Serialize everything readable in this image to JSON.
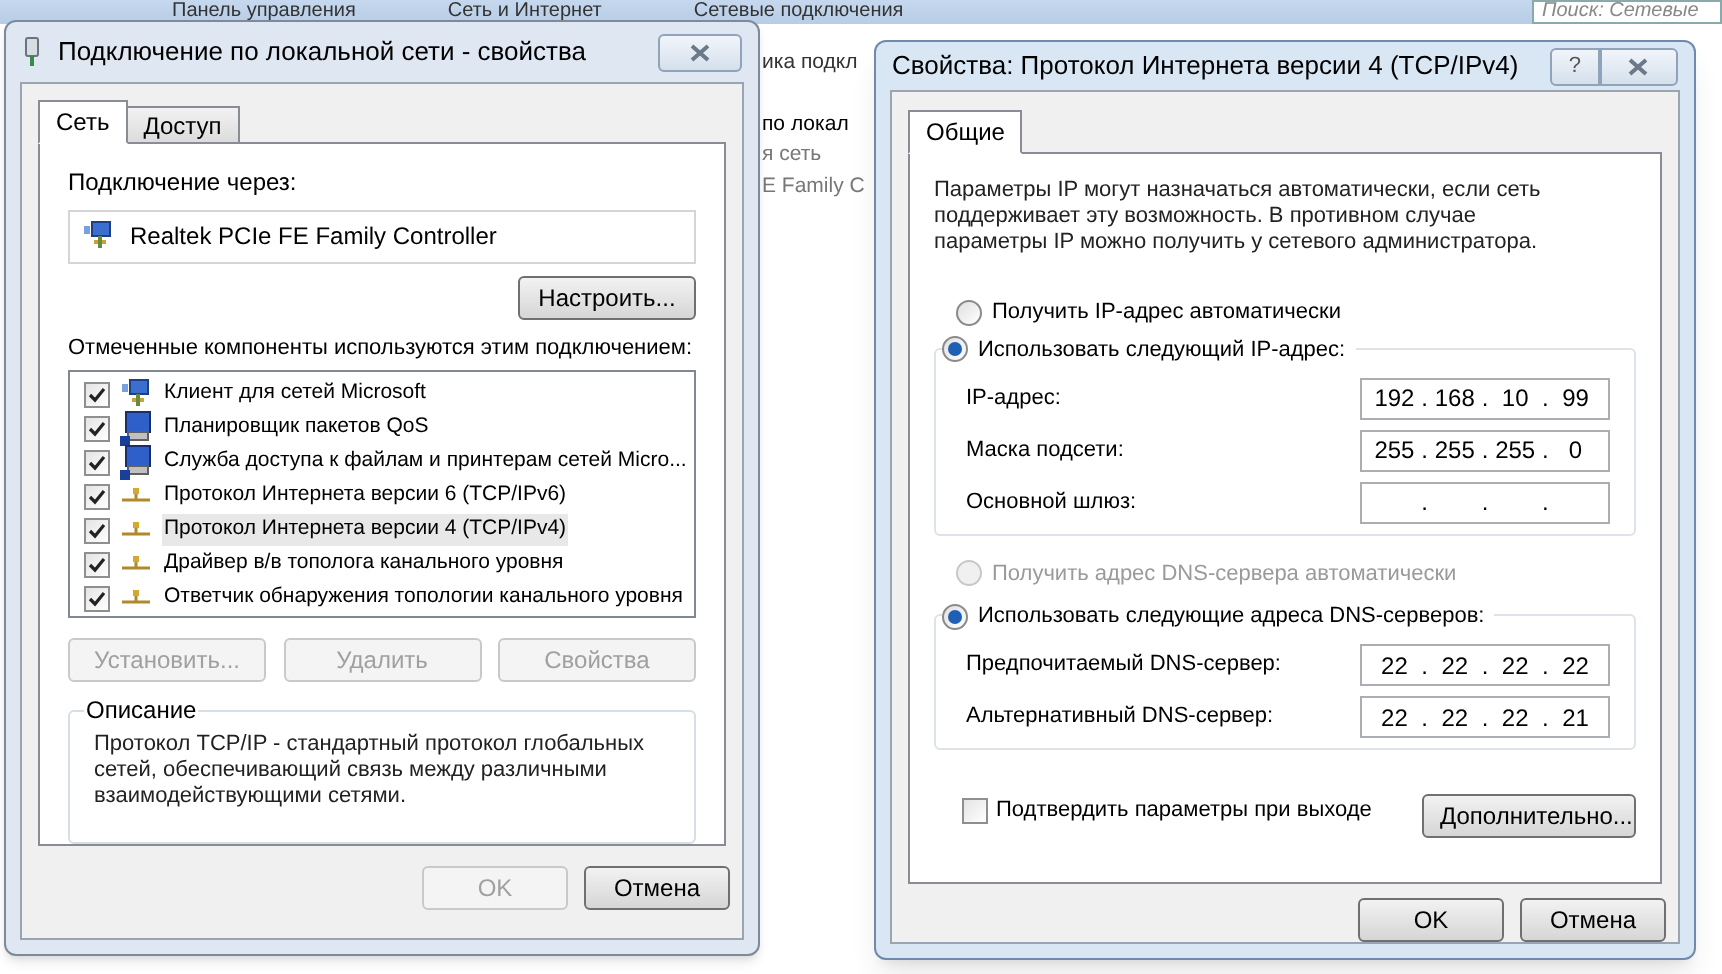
{
  "explorer": {
    "breadcrumb": [
      "Панель управления",
      "Сеть и Интернет",
      "Сетевые подключения"
    ],
    "search": {
      "placeholder": "Поиск: Сетевые"
    },
    "fragments": [
      "ика подкл",
      "по локал",
      "я сеть",
      "E Family C"
    ]
  },
  "left_dialog": {
    "title": "Подключение по локальной сети - свойства",
    "tabs": [
      {
        "label": "Сеть",
        "selected": true
      },
      {
        "label": "Доступ",
        "selected": false
      }
    ],
    "connect_label": "Подключение через:",
    "adapter": "Realtek PCIe FE Family Controller",
    "configure_button": "Настроить...",
    "components_label": "Отмеченные компоненты используются этим подключением:",
    "components": [
      {
        "kind": "client",
        "label": "Клиент для сетей Microsoft",
        "checked": true,
        "selected": false
      },
      {
        "kind": "service",
        "label": "Планировщик пакетов QoS",
        "checked": true,
        "selected": false
      },
      {
        "kind": "service",
        "label": "Служба доступа к файлам и принтерам сетей Micro...",
        "checked": true,
        "selected": false
      },
      {
        "kind": "protocol",
        "label": "Протокол Интернета версии 6 (TCP/IPv6)",
        "checked": true,
        "selected": false
      },
      {
        "kind": "protocol",
        "label": "Протокол Интернета версии 4 (TCP/IPv4)",
        "checked": true,
        "selected": true
      },
      {
        "kind": "protocol",
        "label": "Драйвер в/в тополога канального уровня",
        "checked": true,
        "selected": false
      },
      {
        "kind": "protocol",
        "label": "Ответчик обнаружения топологии канального уровня",
        "checked": true,
        "selected": false
      }
    ],
    "buttons": [
      {
        "label": "Установить...",
        "disabled": true
      },
      {
        "label": "Удалить",
        "disabled": true
      },
      {
        "label": "Свойства",
        "disabled": true
      }
    ],
    "description": {
      "title": "Описание",
      "text": "Протокол TCP/IP - стандартный протокол глобальных сетей, обеспечивающий связь между различными взаимодействующими сетями."
    },
    "footer_buttons": [
      {
        "label": "OK",
        "disabled": true
      },
      {
        "label": "Отмена",
        "disabled": false
      }
    ]
  },
  "right_dialog": {
    "title": "Свойства: Протокол Интернета версии 4 (TCP/IPv4)",
    "help": "?",
    "tabs": [
      {
        "label": "Общие",
        "selected": true
      }
    ],
    "intro": "Параметры IP могут назначаться автоматически, если сеть поддерживает эту возможность. В противном случае параметры IP можно получить у сетевого администратора.",
    "separator": ".",
    "ip_mode": [
      {
        "label": "Получить IP-адрес автоматически",
        "selected": false
      },
      {
        "label": "Использовать следующий IP-адрес:",
        "selected": true
      }
    ],
    "ip_fields": [
      {
        "label": "IP-адрес:",
        "octets": [
          "192",
          "168",
          "10",
          "99"
        ]
      },
      {
        "label": "Маска подсети:",
        "octets": [
          "255",
          "255",
          "255",
          "0"
        ]
      },
      {
        "label": "Основной шлюз:"
      }
    ],
    "dns_mode": [
      {
        "label": "Получить адрес DNS-сервера автоматически",
        "selected": false,
        "disabled": true
      },
      {
        "label": "Использовать следующие адреса DNS-серверов:",
        "selected": true,
        "disabled": false
      }
    ],
    "dns_fields": [
      {
        "label": "Предпочитаемый DNS-сервер:",
        "octets": [
          "22",
          "22",
          "22",
          "22"
        ]
      },
      {
        "label": "Альтернативный DNS-сервер:",
        "octets": [
          "22",
          "22",
          "22",
          "21"
        ]
      }
    ],
    "validate": {
      "label": "Подтвердить параметры при выходе",
      "checked": false
    },
    "advanced_button": "Дополнительно...",
    "footer_buttons": [
      "OK",
      "Отмена"
    ]
  }
}
